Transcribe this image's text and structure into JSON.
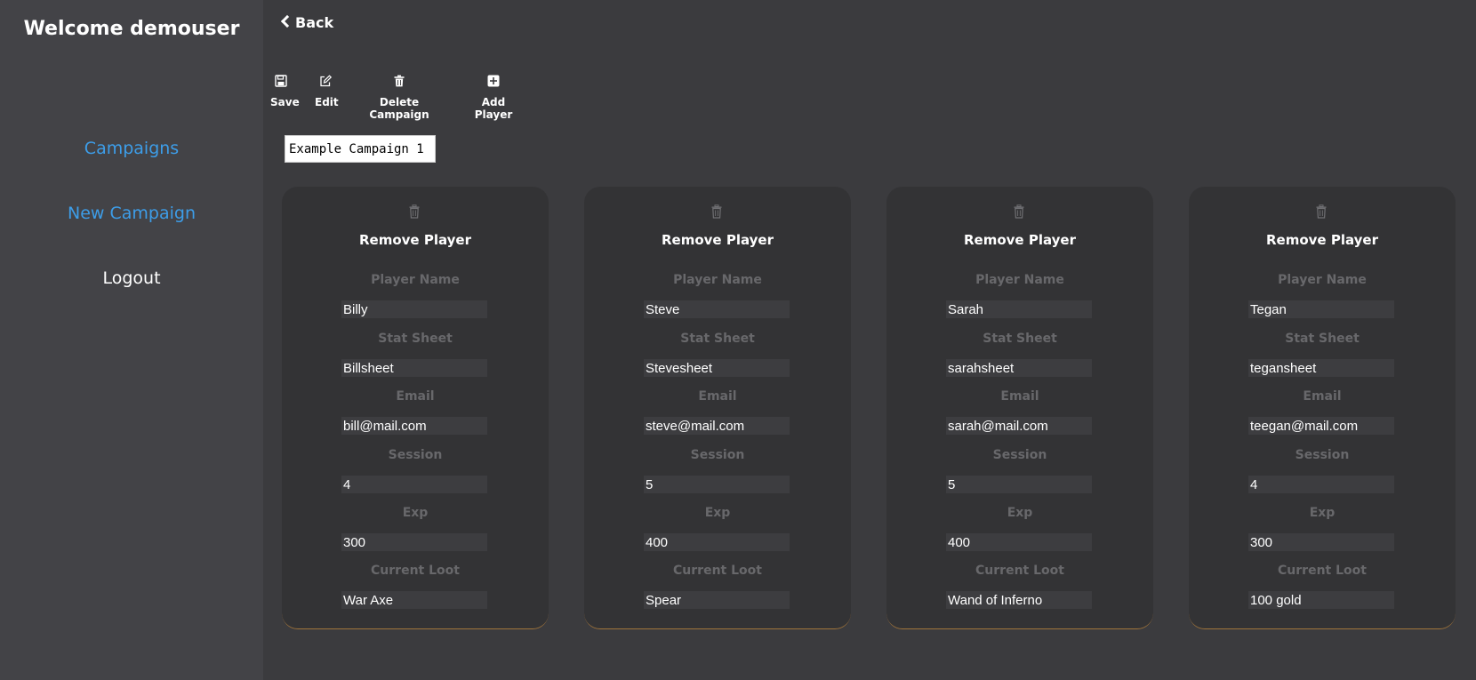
{
  "sidebar": {
    "welcome": "Welcome demouser",
    "campaigns": "Campaigns",
    "new_campaign": "New Campaign",
    "logout": "Logout"
  },
  "header": {
    "back": "Back"
  },
  "toolbar": {
    "save": "Save",
    "edit": "Edit",
    "delete_campaign": "Delete Campaign",
    "add_player": "Add Player"
  },
  "campaign": {
    "name": "Example Campaign 1"
  },
  "card_labels": {
    "remove_player": "Remove Player",
    "player_name": "Player Name",
    "stat_sheet": "Stat Sheet",
    "email": "Email",
    "session": "Session",
    "exp": "Exp",
    "current_loot": "Current Loot"
  },
  "players": [
    {
      "name": "Billy",
      "stat_sheet": "Billsheet",
      "email": "bill@mail.com",
      "session": "4",
      "exp": "300",
      "loot": "War Axe"
    },
    {
      "name": "Steve",
      "stat_sheet": "Stevesheet",
      "email": "steve@mail.com",
      "session": "5",
      "exp": "400",
      "loot": "Spear"
    },
    {
      "name": "Sarah",
      "stat_sheet": "sarahsheet",
      "email": "sarah@mail.com",
      "session": "5",
      "exp": "400",
      "loot": "Wand of Inferno"
    },
    {
      "name": "Tegan",
      "stat_sheet": "tegansheet",
      "email": "teegan@mail.com",
      "session": "4",
      "exp": "300",
      "loot": "100 gold"
    }
  ],
  "colors": {
    "link_blue": "#3d9de8",
    "card_bg": "#333335",
    "sidebar_bg": "#434347",
    "card_accent": "#a0743a"
  },
  "icons": {
    "save": "floppy-disk-icon",
    "edit": "pencil-square-icon",
    "delete": "trash-icon",
    "add": "plus-square-icon",
    "back": "chevron-left-icon"
  }
}
